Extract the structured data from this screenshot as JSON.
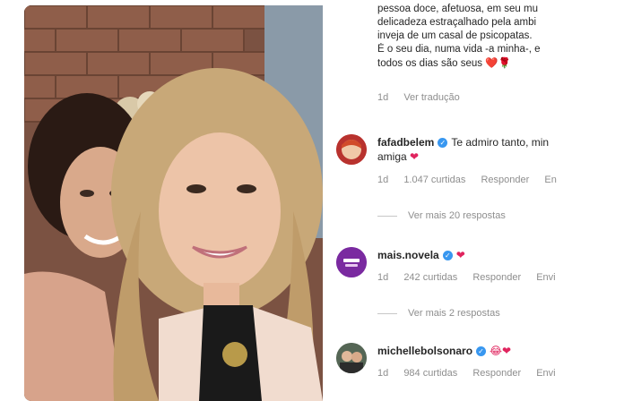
{
  "caption": {
    "lines": [
      "pessoa doce, afetuosa, em seu mu",
      "delicadeza  estraçalhado pela ambi",
      "inveja de um casal de psicopatas.",
      "É o seu dia, numa vida -a minha-, e",
      "todos os dias são seus"
    ],
    "emojis": "❤️🌹",
    "age": "1d",
    "translate": "Ver tradução"
  },
  "comments": [
    {
      "username": "fafadbelem",
      "text": "Te admiro tanto, min",
      "text2": "amiga",
      "emoji": "❤",
      "age": "1d",
      "likes": "1.047 curtidas",
      "reply": "Responder",
      "extra": "En",
      "more_replies": "Ver mais 20 respostas"
    },
    {
      "username": "mais.novela",
      "text": "",
      "emoji": "❤",
      "age": "1d",
      "likes": "242 curtidas",
      "reply": "Responder",
      "extra": "Envi",
      "more_replies": "Ver mais 2 respostas"
    },
    {
      "username": "michellebolsonaro",
      "text": "",
      "emoji": "😂❤",
      "age": "1d",
      "likes": "984 curtidas",
      "reply": "Responder",
      "extra": "Envi"
    }
  ],
  "colors": {
    "verified": "#3897f0",
    "heart": "#e0245e",
    "muted": "#8e8e8e"
  }
}
